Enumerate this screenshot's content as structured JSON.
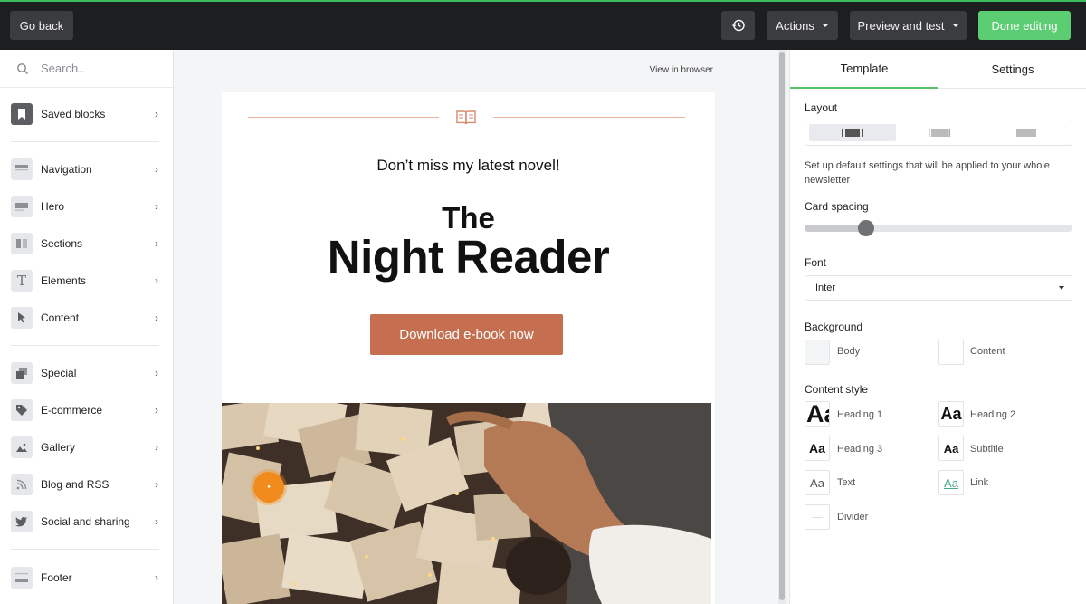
{
  "topbar": {
    "go_back": "Go back",
    "actions": "Actions",
    "preview": "Preview and test",
    "done": "Done editing"
  },
  "sidebar": {
    "search_placeholder": "Search..",
    "items": [
      {
        "label": "Saved blocks",
        "icon": "bookmark-icon"
      },
      {
        "label": "Navigation",
        "icon": "navigation-block-icon"
      },
      {
        "label": "Hero",
        "icon": "hero-block-icon"
      },
      {
        "label": "Sections",
        "icon": "columns-icon"
      },
      {
        "label": "Elements",
        "icon": "text-t-icon"
      },
      {
        "label": "Content",
        "icon": "cursor-icon"
      },
      {
        "label": "Special",
        "icon": "layers-icon"
      },
      {
        "label": "E-commerce",
        "icon": "tag-icon"
      },
      {
        "label": "Gallery",
        "icon": "image-icon"
      },
      {
        "label": "Blog and RSS",
        "icon": "rss-icon"
      },
      {
        "label": "Social and sharing",
        "icon": "twitter-icon"
      },
      {
        "label": "Footer",
        "icon": "footer-block-icon"
      }
    ]
  },
  "canvas": {
    "view_in_browser": "View in browser",
    "email": {
      "tagline": "Don’t miss my latest novel!",
      "title_line1": "The",
      "title_line2": "Night Reader",
      "cta": "Download e-book now"
    }
  },
  "panel": {
    "tabs": [
      "Template",
      "Settings"
    ],
    "active_tab": "Template",
    "layout_label": "Layout",
    "description": "Set up default settings that will be applied to your whole newsletter",
    "card_spacing_label": "Card spacing",
    "card_spacing_level": 0.23,
    "font_label": "Font",
    "font_value": "Inter",
    "background_label": "Background",
    "background_body": "Body",
    "background_content": "Content",
    "content_style_label": "Content style",
    "styles": [
      {
        "sample": "Aa",
        "label": "Heading 1"
      },
      {
        "sample": "Aa",
        "label": "Heading 2"
      },
      {
        "sample": "Aa",
        "label": "Heading 3"
      },
      {
        "sample": "Aa",
        "label": "Subtitle"
      },
      {
        "sample": "Aa",
        "label": "Text"
      },
      {
        "sample": "Aa",
        "label": "Link"
      },
      {
        "sample": "",
        "label": "Divider"
      }
    ]
  },
  "colors": {
    "accent": "#5dcd73",
    "cta": "#c56f50",
    "divider_line": "#e5b2a2",
    "topbar": "#1d1e20",
    "link": "#4aa88e"
  }
}
